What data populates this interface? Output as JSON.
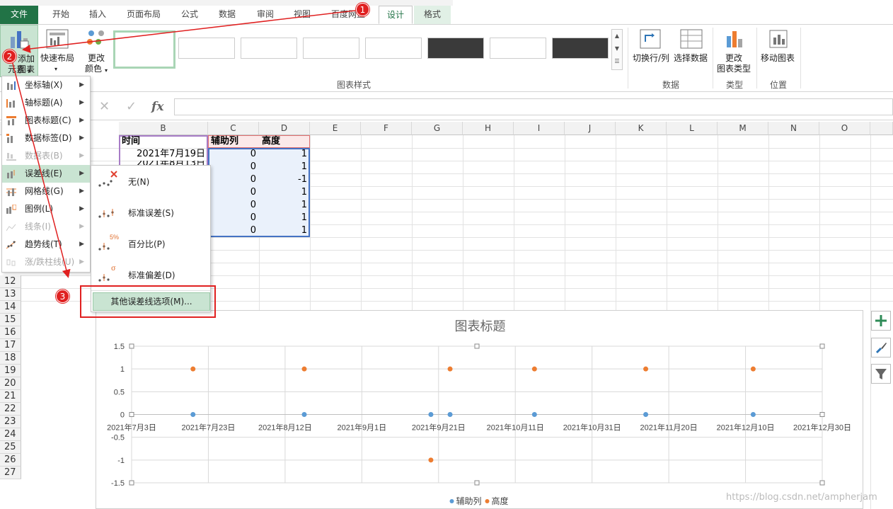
{
  "tabs": [
    {
      "label": "文件"
    },
    {
      "label": "开始"
    },
    {
      "label": "插入"
    },
    {
      "label": "页面布局"
    },
    {
      "label": "公式"
    },
    {
      "label": "数据"
    },
    {
      "label": "审阅"
    },
    {
      "label": "视图"
    },
    {
      "label": "百度网盘"
    },
    {
      "label": "设计"
    },
    {
      "label": "格式"
    }
  ],
  "ribbon": {
    "add_element_l1": "添加图表",
    "add_element_l2": "元素",
    "quick_layout": "快速布局",
    "change_color_l1": "更改",
    "change_color_l2": "颜色",
    "group_styles": "图表样式",
    "switch_rowcol": "切换行/列",
    "select_data": "选择数据",
    "group_data": "数据",
    "change_type_l1": "更改",
    "change_type_l2": "图表类型",
    "group_type": "类型",
    "move_chart": "移动图表",
    "group_location": "位置"
  },
  "formula_bar": {
    "cancel": "✕",
    "enter": "✓",
    "fx": "fx",
    "value": ""
  },
  "columns": [
    "B",
    "C",
    "D",
    "E",
    "F",
    "G",
    "H",
    "I",
    "J",
    "K",
    "L",
    "M",
    "N",
    "O"
  ],
  "rows": [
    "12",
    "13",
    "14",
    "15",
    "16",
    "17",
    "18",
    "19",
    "20",
    "21",
    "22",
    "23",
    "24",
    "25",
    "26",
    "27"
  ],
  "table": {
    "headers": {
      "time": "时间",
      "aux": "辅助列",
      "height": "高度"
    },
    "first_time": "2021年7月19日",
    "second_time_partial": "2021年8月13日",
    "aux": [
      "0",
      "0",
      "0",
      "0",
      "0",
      "0",
      "0"
    ],
    "height": [
      "1",
      "1",
      "-1",
      "1",
      "1",
      "1",
      "1"
    ]
  },
  "menu_main": [
    {
      "label": "坐标轴(X)",
      "enabled": true
    },
    {
      "label": "轴标题(A)",
      "enabled": true
    },
    {
      "label": "图表标题(C)",
      "enabled": true
    },
    {
      "label": "数据标签(D)",
      "enabled": true
    },
    {
      "label": "数据表(B)",
      "enabled": false
    },
    {
      "label": "误差线(E)",
      "enabled": true
    },
    {
      "label": "网格线(G)",
      "enabled": true
    },
    {
      "label": "图例(L)",
      "enabled": true
    },
    {
      "label": "线条(I)",
      "enabled": false
    },
    {
      "label": "趋势线(T)",
      "enabled": true
    },
    {
      "label": "涨/跌柱线(U)",
      "enabled": false
    }
  ],
  "menu_sub": [
    {
      "label": "无(N)"
    },
    {
      "label": "标准误差(S)"
    },
    {
      "label": "百分比(P)"
    },
    {
      "label": "标准偏差(D)"
    }
  ],
  "menu_sub_more": "其他误差线选项(M)...",
  "annotations": [
    "1",
    "2",
    "3"
  ],
  "chart": {
    "title": "图表标题"
  },
  "watermark": "https://blog.csdn.net/ampherjam",
  "colors": {
    "excel_green": "#217346",
    "series_aux": "#5b9bd5",
    "series_height": "#ed7d31",
    "annotation_red": "#e02020"
  },
  "chart_data": {
    "type": "scatter",
    "title": "图表标题",
    "x_tick_labels": [
      "2021年7月3日",
      "2021年7月23日",
      "2021年8月12日",
      "2021年9月1日",
      "2021年9月21日",
      "2021年10月11日",
      "2021年10月31日",
      "2021年11月20日",
      "2021年12月10日",
      "2021年12月30日"
    ],
    "y_tick_labels": [
      "1.5",
      "1",
      "0.5",
      "0",
      "-0.5",
      "-1",
      "-1.5"
    ],
    "ylim": [
      -1.5,
      1.5
    ],
    "xlim": [
      "2021-07-03",
      "2021-12-30"
    ],
    "grid": true,
    "legend_position": "bottom",
    "series": [
      {
        "name": "辅助列",
        "color": "#5b9bd5",
        "points": [
          {
            "x": "2021-07-19",
            "y": 0
          },
          {
            "x": "2021-08-17",
            "y": 0
          },
          {
            "x": "2021-09-19",
            "y": 0
          },
          {
            "x": "2021-09-24",
            "y": 0
          },
          {
            "x": "2021-10-16",
            "y": 0
          },
          {
            "x": "2021-11-14",
            "y": 0
          },
          {
            "x": "2021-12-12",
            "y": 0
          }
        ]
      },
      {
        "name": "高度",
        "color": "#ed7d31",
        "points": [
          {
            "x": "2021-07-19",
            "y": 1
          },
          {
            "x": "2021-08-17",
            "y": 1
          },
          {
            "x": "2021-09-19",
            "y": -1
          },
          {
            "x": "2021-09-24",
            "y": 1
          },
          {
            "x": "2021-10-16",
            "y": 1
          },
          {
            "x": "2021-11-14",
            "y": 1
          },
          {
            "x": "2021-12-12",
            "y": 1
          }
        ]
      }
    ]
  }
}
